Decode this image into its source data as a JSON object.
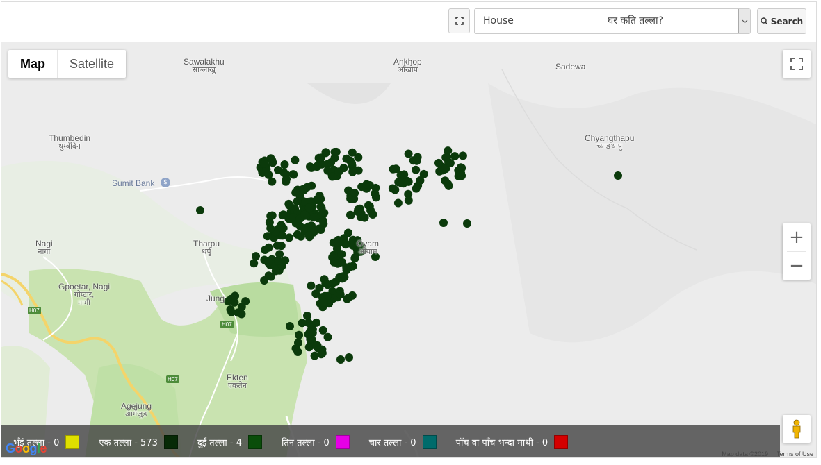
{
  "toolbar": {
    "category_value": "House",
    "question_value": "घर कति तल्ला?",
    "search_label": "Search"
  },
  "map": {
    "type_buttons": [
      {
        "label": "Map",
        "active": true
      },
      {
        "label": "Satellite",
        "active": false
      }
    ],
    "places": [
      {
        "name": "Sawalakhu",
        "native": "साब्लाखु"
      },
      {
        "name": "Ankhop",
        "native": "आँखोप"
      },
      {
        "name": "Sadewa",
        "native": ""
      },
      {
        "name": "Thumbedin",
        "native": "थुम्बेदिन"
      },
      {
        "name": "Chyangthapu",
        "native": "च्याङथापु"
      },
      {
        "name": "Nagi",
        "native": "नागी"
      },
      {
        "name": "Tharpu",
        "native": "थर्पु"
      },
      {
        "name": "Oyam",
        "native": "ओयाम"
      },
      {
        "name": "Gpoetar, Nagi",
        "native": "गोप्टार,"
      },
      {
        "name": "Jung",
        "native": ""
      },
      {
        "name": "Ekten",
        "native": "एकतेन"
      },
      {
        "name": "Agejung",
        "native": "आगेजुङ"
      }
    ],
    "poi": "Sumit Bank",
    "road_badges": [
      "H07",
      "H07",
      "H07"
    ],
    "google_logo": "Google",
    "attribution": {
      "data": "Map data ©2019",
      "terms": "Terms of Use"
    },
    "marker_color": "#0b3a0b",
    "marker_icon": "circle-marker"
  },
  "legend": [
    {
      "label": "भूँइं तल्ला - 0",
      "color": "#e0e000"
    },
    {
      "label": "एक तल्ला - 573",
      "color": "#062a06"
    },
    {
      "label": "दुई तल्ला - 4",
      "color": "#0a4d0a"
    },
    {
      "label": "तिन तल्ला - 0",
      "color": "#e600e6"
    },
    {
      "label": "चार तल्ला - 0",
      "color": "#006b6b"
    },
    {
      "label": "पाँच वा पाँच भन्दा माथी - 0",
      "color": "#d40000"
    }
  ]
}
